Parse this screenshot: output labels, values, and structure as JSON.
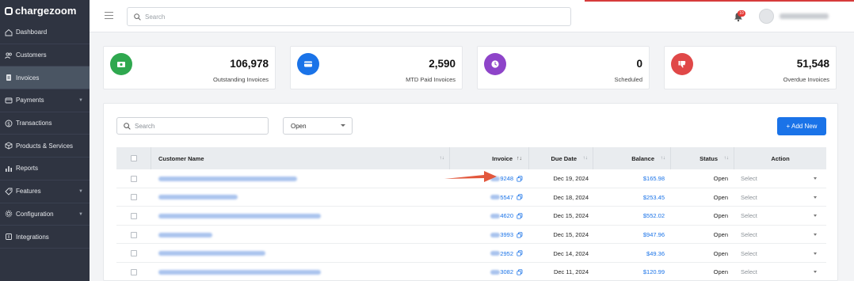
{
  "app": {
    "logo_text": "chargezoom"
  },
  "sidebar": {
    "items": [
      {
        "label": "Dashboard",
        "icon": "home-icon",
        "active": false,
        "has_chevron": false
      },
      {
        "label": "Customers",
        "icon": "users-icon",
        "active": false,
        "has_chevron": false
      },
      {
        "label": "Invoices",
        "icon": "invoice-icon",
        "active": true,
        "has_chevron": false
      },
      {
        "label": "Payments",
        "icon": "card-icon",
        "active": false,
        "has_chevron": true
      },
      {
        "label": "Transactions",
        "icon": "dollar-icon",
        "active": false,
        "has_chevron": false
      },
      {
        "label": "Products & Services",
        "icon": "box-icon",
        "active": false,
        "has_chevron": false
      },
      {
        "label": "Reports",
        "icon": "bar-chart-icon",
        "active": false,
        "has_chevron": false
      },
      {
        "label": "Features",
        "icon": "tag-icon",
        "active": false,
        "has_chevron": true
      },
      {
        "label": "Configuration",
        "icon": "gear-icon",
        "active": false,
        "has_chevron": true
      },
      {
        "label": "Integrations",
        "icon": "plug-icon",
        "active": false,
        "has_chevron": false
      }
    ]
  },
  "topbar": {
    "search_placeholder": "Search",
    "notification_count": "10"
  },
  "stats": [
    {
      "value": "106,978",
      "label": "Outstanding Invoices",
      "color": "#2fa84f",
      "icon": "cash-icon"
    },
    {
      "value": "2,590",
      "label": "MTD Paid Invoices",
      "color": "#1a73e8",
      "icon": "card-icon"
    },
    {
      "value": "0",
      "label": "Scheduled",
      "color": "#8e44c9",
      "icon": "clock-icon"
    },
    {
      "value": "51,548",
      "label": "Overdue Invoices",
      "color": "#e04848",
      "icon": "thumbs-down-icon"
    }
  ],
  "toolbar": {
    "search_placeholder": "Search",
    "status_filter": "Open",
    "add_new_label": "+ Add New"
  },
  "table": {
    "columns": {
      "customer_name": "Customer Name",
      "invoice": "Invoice",
      "due_date": "Due Date",
      "balance": "Balance",
      "status": "Status",
      "action": "Action"
    },
    "rows": [
      {
        "invoice_suffix": "9248",
        "due_date": "Dec 19, 2024",
        "balance": "$165.98",
        "status": "Open",
        "action": "Select"
      },
      {
        "invoice_suffix": "5547",
        "due_date": "Dec 18, 2024",
        "balance": "$253.45",
        "status": "Open",
        "action": "Select"
      },
      {
        "invoice_suffix": "4620",
        "due_date": "Dec 15, 2024",
        "balance": "$552.02",
        "status": "Open",
        "action": "Select"
      },
      {
        "invoice_suffix": "3993",
        "due_date": "Dec 15, 2024",
        "balance": "$947.96",
        "status": "Open",
        "action": "Select"
      },
      {
        "invoice_suffix": "2952",
        "due_date": "Dec 14, 2024",
        "balance": "$49.36",
        "status": "Open",
        "action": "Select"
      },
      {
        "invoice_suffix": "3082",
        "due_date": "Dec 11, 2024",
        "balance": "$120.99",
        "status": "Open",
        "action": "Select"
      }
    ]
  }
}
